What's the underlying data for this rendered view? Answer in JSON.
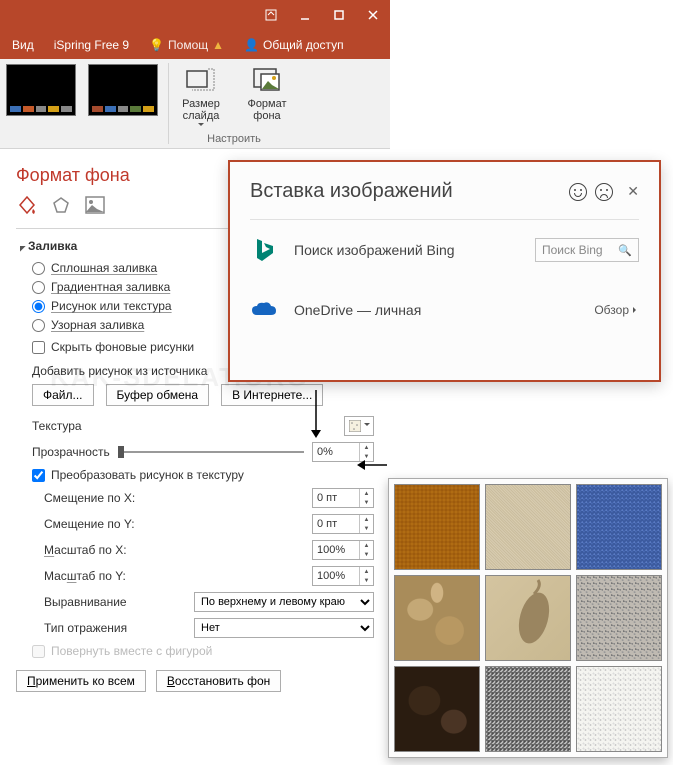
{
  "titlebar": {},
  "tabs": {
    "view": "Вид",
    "ispring": "iSpring Free 9",
    "help": "Помощ",
    "share": "Общий доступ"
  },
  "ribbon": {
    "slideSize": "Размер\nслайда",
    "bgFormat": "Формат\nфона",
    "group": "Настроить"
  },
  "pane": {
    "title": "Формат фона",
    "section": "Заливка",
    "radios": {
      "solid": "Сплошная заливка",
      "gradient": "Градиентная заливка",
      "picture": "Рисунок или текстура",
      "pattern": "Узорная заливка"
    },
    "hideBg": "Скрыть фоновые рисунки",
    "addPicLabel": "Добавить рисунок из источника",
    "btnFile": "Файл...",
    "btnClipboard": "Буфер обмена",
    "btnOnline": "В Интернете...",
    "texture": "Текстура",
    "transparency": "Прозрачность",
    "transVal": "0%",
    "tile": "Преобразовать рисунок в текстуру",
    "offsetX": "Смещение по X:",
    "offsetY": "Смещение по Y:",
    "offVal": "0 пт",
    "scaleX": "Масштаб по X:",
    "scaleY": "Масштаб по Y:",
    "scaleVal": "100%",
    "align": "Выравнивание",
    "alignVal": "По верхнему и левому краю",
    "mirror": "Тип отражения",
    "mirrorVal": "Нет",
    "rotate": "Повернуть вместе с фигурой",
    "applyAll": "Применить ко всем",
    "reset": "Восстановить фон"
  },
  "dialog": {
    "title": "Вставка изображений",
    "bing": "Поиск изображений Bing",
    "bingPh": "Поиск Bing",
    "onedrive": "OneDrive — личная",
    "browse": "Обзор"
  },
  "watermark": "KAK-SDELAT.ORG"
}
